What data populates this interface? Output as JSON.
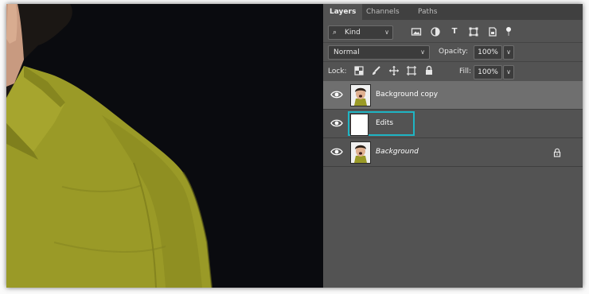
{
  "tabs": [
    {
      "label": "Layers",
      "active": true
    },
    {
      "label": "Channels",
      "active": false
    },
    {
      "label": "Paths",
      "active": false
    }
  ],
  "filter": {
    "kind_label": "Kind",
    "icons": [
      "image-filter-icon",
      "adjustment-filter-icon",
      "type-filter-icon",
      "shape-filter-icon",
      "smart-object-filter-icon",
      "filter-toggle-icon"
    ]
  },
  "blend": {
    "mode": "Normal",
    "opacity_label": "Opacity:",
    "opacity_value": "100%"
  },
  "lock": {
    "label": "Lock:",
    "icons": [
      "lock-transparent-pixels-icon",
      "lock-image-pixels-icon",
      "lock-position-icon",
      "lock-artboard-icon",
      "lock-all-icon"
    ],
    "fill_label": "Fill:",
    "fill_value": "100%"
  },
  "layers": [
    {
      "name": "Background copy",
      "selected": true,
      "thumb": "photo",
      "italic": false,
      "locked": false
    },
    {
      "name": "Edits",
      "selected": false,
      "thumb": "white",
      "italic": false,
      "locked": false,
      "highlighted": true
    },
    {
      "name": "Background",
      "selected": false,
      "thumb": "photo",
      "italic": true,
      "locked": true
    }
  ],
  "colors": {
    "panel_bg": "#535353",
    "selected_row": "#6f6f6f",
    "highlight_border": "#1fb5c4",
    "shirt": "#9a9a2a"
  }
}
